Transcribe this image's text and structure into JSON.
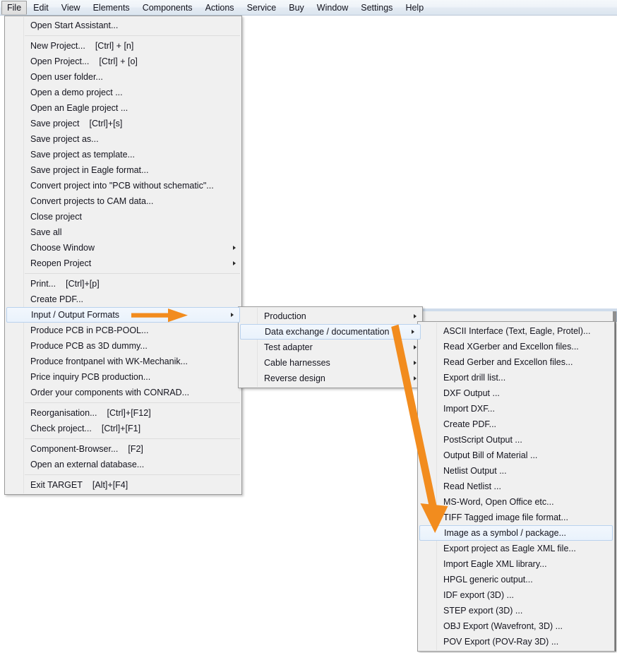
{
  "menubar": {
    "items": [
      {
        "label": "File",
        "active": true
      },
      {
        "label": "Edit",
        "active": false
      },
      {
        "label": "View",
        "active": false
      },
      {
        "label": "Elements",
        "active": false
      },
      {
        "label": "Components",
        "active": false
      },
      {
        "label": "Actions",
        "active": false
      },
      {
        "label": "Service",
        "active": false
      },
      {
        "label": "Buy",
        "active": false
      },
      {
        "label": "Window",
        "active": false
      },
      {
        "label": "Settings",
        "active": false
      },
      {
        "label": "Help",
        "active": false
      }
    ]
  },
  "file_menu": {
    "groups": [
      [
        {
          "label": "Open Start Assistant...",
          "accel": "",
          "submenu": false,
          "selected": false
        }
      ],
      [
        {
          "label": "New Project...",
          "accel": "[Ctrl] + [n]",
          "submenu": false,
          "selected": false
        },
        {
          "label": "Open Project...",
          "accel": "[Ctrl] + [o]",
          "submenu": false,
          "selected": false
        },
        {
          "label": "Open user folder...",
          "accel": "",
          "submenu": false,
          "selected": false
        },
        {
          "label": "Open a demo project ...",
          "accel": "",
          "submenu": false,
          "selected": false
        },
        {
          "label": "Open an Eagle project ...",
          "accel": "",
          "submenu": false,
          "selected": false
        },
        {
          "label": "Save project",
          "accel": "[Ctrl]+[s]",
          "submenu": false,
          "selected": false
        },
        {
          "label": "Save project as...",
          "accel": "",
          "submenu": false,
          "selected": false
        },
        {
          "label": "Save project as template...",
          "accel": "",
          "submenu": false,
          "selected": false
        },
        {
          "label": "Save project in Eagle format...",
          "accel": "",
          "submenu": false,
          "selected": false
        },
        {
          "label": "Convert project into \"PCB without schematic\"...",
          "accel": "",
          "submenu": false,
          "selected": false
        },
        {
          "label": "Convert projects to CAM data...",
          "accel": "",
          "submenu": false,
          "selected": false
        },
        {
          "label": "Close project",
          "accel": "",
          "submenu": false,
          "selected": false
        },
        {
          "label": "Save all",
          "accel": "",
          "submenu": false,
          "selected": false
        },
        {
          "label": "Choose Window",
          "accel": "",
          "submenu": true,
          "selected": false
        },
        {
          "label": "Reopen Project",
          "accel": "",
          "submenu": true,
          "selected": false
        }
      ],
      [
        {
          "label": "Print...",
          "accel": "[Ctrl]+[p]",
          "submenu": false,
          "selected": false
        },
        {
          "label": "Create PDF...",
          "accel": "",
          "submenu": false,
          "selected": false
        },
        {
          "label": "Input / Output Formats",
          "accel": "",
          "submenu": true,
          "selected": true
        },
        {
          "label": "Produce PCB in PCB-POOL...",
          "accel": "",
          "submenu": false,
          "selected": false
        },
        {
          "label": "Produce PCB as 3D dummy...",
          "accel": "",
          "submenu": false,
          "selected": false
        },
        {
          "label": "Produce frontpanel with WK-Mechanik...",
          "accel": "",
          "submenu": false,
          "selected": false
        },
        {
          "label": "Price inquiry PCB production...",
          "accel": "",
          "submenu": false,
          "selected": false
        },
        {
          "label": "Order your components with CONRAD...",
          "accel": "",
          "submenu": false,
          "selected": false
        }
      ],
      [
        {
          "label": "Reorganisation...",
          "accel": "[Ctrl]+[F12]",
          "submenu": false,
          "selected": false
        },
        {
          "label": "Check project...",
          "accel": "[Ctrl]+[F1]",
          "submenu": false,
          "selected": false
        }
      ],
      [
        {
          "label": "Component-Browser...",
          "accel": "[F2]",
          "submenu": false,
          "selected": false
        },
        {
          "label": "Open an external database...",
          "accel": "",
          "submenu": false,
          "selected": false
        }
      ],
      [
        {
          "label": "Exit TARGET",
          "accel": "[Alt]+[F4]",
          "submenu": false,
          "selected": false
        }
      ]
    ]
  },
  "io_formats_menu": {
    "items": [
      {
        "label": "Production",
        "submenu": true,
        "selected": false
      },
      {
        "label": "Data exchange / documentation",
        "submenu": true,
        "selected": true
      },
      {
        "label": "Test adapter",
        "submenu": true,
        "selected": false
      },
      {
        "label": "Cable harnesses",
        "submenu": true,
        "selected": false
      },
      {
        "label": "Reverse design",
        "submenu": true,
        "selected": false
      }
    ]
  },
  "data_exchange_menu": {
    "items": [
      {
        "label": "ASCII Interface (Text, Eagle, Protel)...",
        "selected": false
      },
      {
        "label": "Read XGerber and Excellon files...",
        "selected": false
      },
      {
        "label": "Read Gerber and Excellon files...",
        "selected": false
      },
      {
        "label": "Export drill list...",
        "selected": false
      },
      {
        "label": "DXF Output ...",
        "selected": false
      },
      {
        "label": "Import DXF...",
        "selected": false
      },
      {
        "label": "Create PDF...",
        "selected": false
      },
      {
        "label": "PostScript Output ...",
        "selected": false
      },
      {
        "label": "Output Bill of Material ...",
        "selected": false
      },
      {
        "label": "Netlist Output ...",
        "selected": false
      },
      {
        "label": "Read Netlist ...",
        "selected": false
      },
      {
        "label": "MS-Word, Open Office etc...",
        "selected": false
      },
      {
        "label": "TIFF Tagged image file format...",
        "selected": false
      },
      {
        "label": "Image as a symbol / package...",
        "selected": true
      },
      {
        "label": "Export project as Eagle XML file...",
        "selected": false
      },
      {
        "label": "Import Eagle XML library...",
        "selected": false
      },
      {
        "label": "HPGL generic output...",
        "selected": false
      },
      {
        "label": "IDF export (3D) ...",
        "selected": false
      },
      {
        "label": "STEP export (3D) ...",
        "selected": false
      },
      {
        "label": "OBJ Export (Wavefront, 3D) ...",
        "selected": false
      },
      {
        "label": "POV Export (POV-Ray 3D) ...",
        "selected": false
      }
    ]
  },
  "annotations": {
    "accent_color": "#f28c1e",
    "arrows": [
      {
        "name": "arrow-to-input-output-formats",
        "direction": "horizontal-right"
      },
      {
        "name": "arrow-to-image-as-symbol",
        "direction": "diagonal-down-right"
      }
    ]
  },
  "colors": {
    "menu_bg": "#f0f0f0",
    "menu_border": "#9a9a9a",
    "highlight_bg": "#eaf2fc",
    "highlight_border": "#b9d2ee",
    "accent": "#f28c1e",
    "menubar_gradient_top": "#f5f8fb",
    "menubar_gradient_bottom": "#dbe5ef"
  }
}
